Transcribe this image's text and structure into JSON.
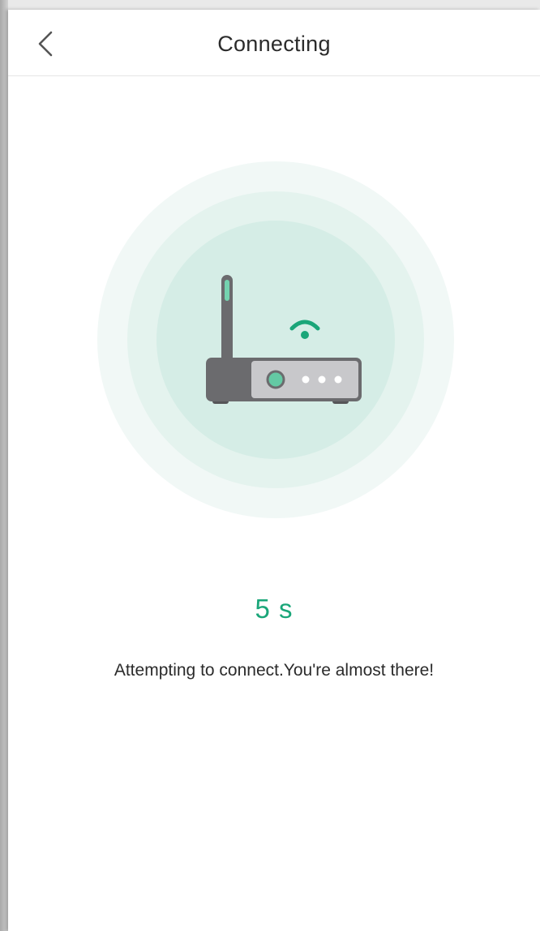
{
  "header": {
    "title": "Connecting",
    "back_icon": "chevron-left-icon"
  },
  "illustration": {
    "icon": "router-icon",
    "wifi_icon": "wifi-signal-icon"
  },
  "status": {
    "countdown": "5 s",
    "message": "Attempting to connect.You're almost there!"
  },
  "colors": {
    "accent": "#1aa679",
    "ring_outer": "#f1f8f6",
    "ring_middle": "#e4f3ee",
    "ring_inner": "#d5ede6",
    "router_dark": "#6b6b6e",
    "router_panel": "#c8c8cb",
    "router_led": "#64c9a4",
    "antenna_tip": "#74d3b0"
  }
}
